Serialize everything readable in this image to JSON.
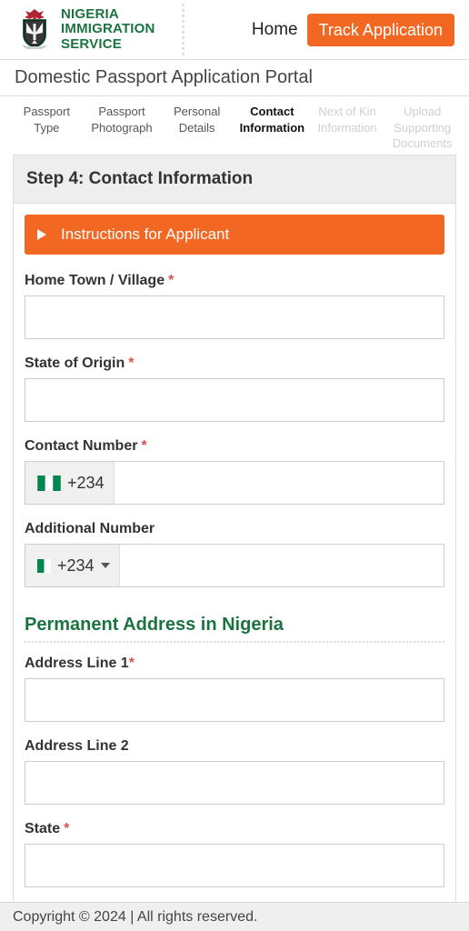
{
  "header": {
    "logo_icon": "nigeria-coat-of-arms-icon",
    "brand_lines": [
      "NIGERIA",
      "IMMIGRATION",
      "SERVICE"
    ],
    "nav": {
      "home_label": "Home",
      "track_label": "Track Application"
    }
  },
  "portal": {
    "title": "Domestic Passport Application Portal"
  },
  "steps": [
    {
      "label": "Passport Type",
      "state": "complete"
    },
    {
      "label": "Passport Photograph",
      "state": "complete"
    },
    {
      "label": "Personal Details",
      "state": "complete"
    },
    {
      "label": "Contact Information",
      "state": "active"
    },
    {
      "label": "Next of Kin Information",
      "state": "disabled"
    },
    {
      "label": "Upload Supporting Documents",
      "state": "disabled"
    }
  ],
  "card": {
    "title": "Step 4: Contact Information",
    "instructions_label": "Instructions for Applicant",
    "instructions_icon": "caret-right-icon"
  },
  "form": {
    "home_town": {
      "label": "Home Town / Village",
      "required_mark": "*",
      "value": "",
      "placeholder": ""
    },
    "state_of_origin": {
      "label": "State of Origin",
      "required_mark": "*",
      "value": "",
      "placeholder": ""
    },
    "contact_number": {
      "label": "Contact Number",
      "required_mark": "*",
      "country_code": "+234",
      "flag_icon": "nigeria-flag-icon",
      "value": "",
      "placeholder": ""
    },
    "additional_number": {
      "label": "Additional Number",
      "required_mark": "",
      "country_code": "+234",
      "flag_icon": "nigeria-flag-icon",
      "dropdown_icon": "caret-down-icon",
      "value": "",
      "placeholder": ""
    },
    "permanent_address": {
      "heading": "Permanent Address in Nigeria",
      "address_line_1": {
        "label": "Address Line 1",
        "required_mark": "*",
        "value": "",
        "placeholder": ""
      },
      "address_line_2": {
        "label": "Address Line 2",
        "required_mark": "",
        "value": "",
        "placeholder": ""
      },
      "state": {
        "label": "State",
        "required_mark": "*"
      }
    }
  },
  "footer": {
    "copyright": "Copyright © 2024 | All rights reserved."
  },
  "colors": {
    "brand_green": "#1d7340",
    "accent_orange": "#f26722",
    "required_red": "#d9534f",
    "panel_grey": "#eeeeee",
    "footer_grey": "#efefef"
  }
}
